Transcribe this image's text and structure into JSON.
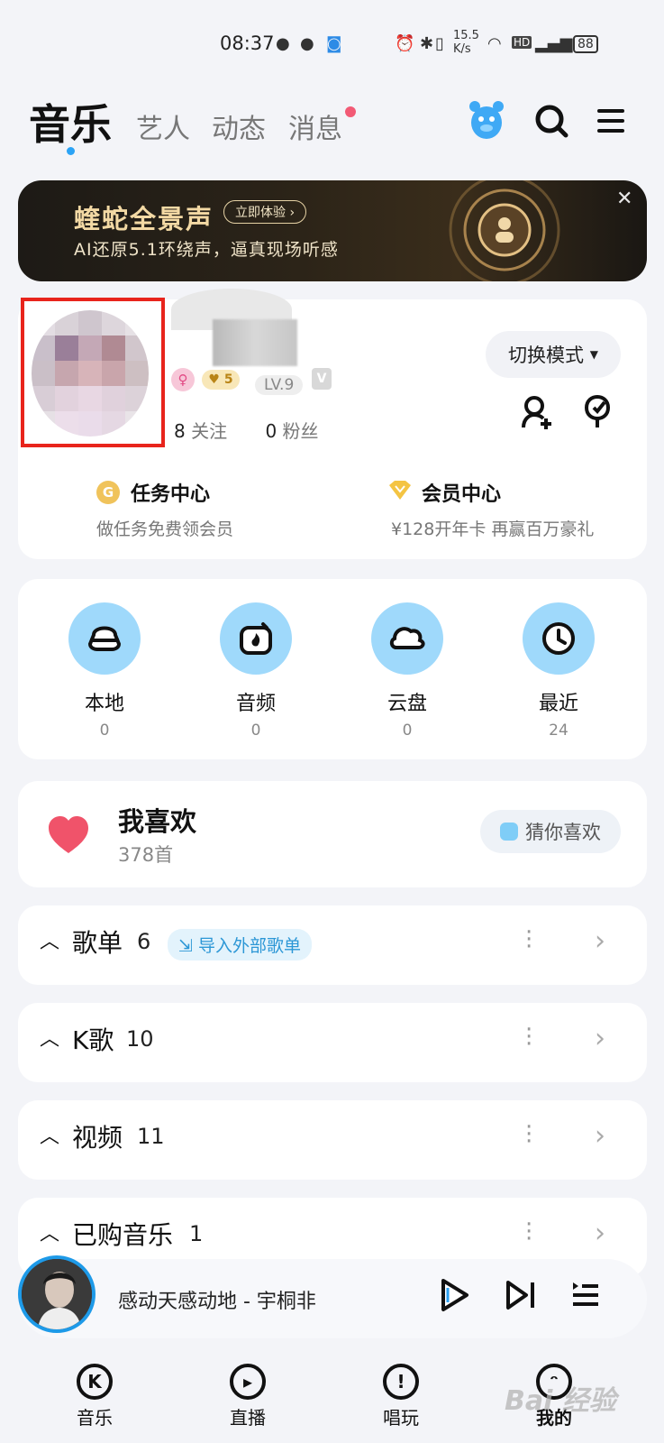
{
  "status_bar": {
    "time": "08:37",
    "net_speed": "15.5\nK/s",
    "battery": "88",
    "icons": [
      "wechat-icon",
      "message-icon",
      "app-icon",
      "alarm-icon",
      "bluetooth-icon",
      "vibrate-icon",
      "wifi-icon",
      "hd-icon",
      "signal-5g-icon",
      "battery-icon"
    ]
  },
  "nav": {
    "tabs": [
      "音乐",
      "艺人",
      "动态",
      "消息"
    ],
    "active_tab": "音乐",
    "icons": [
      "mascot-icon",
      "search-icon",
      "menu-icon"
    ]
  },
  "banner": {
    "title": "蝰蛇全景声",
    "button": "立即体验",
    "subtitle": "AI还原5.1环绕声，逼真现场听感"
  },
  "profile": {
    "level": "LV.9",
    "vip_level": "5",
    "following_count": "8",
    "following_label": "关注",
    "fans_count": "0",
    "fans_label": "粉丝",
    "switch_mode": "切换模式",
    "task_title": "任务中心",
    "task_sub": "做任务免费领会员",
    "vip_title": "会员中心",
    "vip_sub": "¥128开年卡 再赢百万豪礼"
  },
  "quick": [
    {
      "label": "本地",
      "count": "0",
      "icon": "local-icon"
    },
    {
      "label": "音频",
      "count": "0",
      "icon": "audio-icon"
    },
    {
      "label": "云盘",
      "count": "0",
      "icon": "cloud-icon"
    },
    {
      "label": "最近",
      "count": "24",
      "icon": "clock-icon"
    }
  ],
  "favorite": {
    "title": "我喜欢",
    "count": "378首",
    "guess": "猜你喜欢"
  },
  "lists": [
    {
      "title": "歌单",
      "count": "6",
      "extra": "导入外部歌单"
    },
    {
      "title": "K歌",
      "count": "10"
    },
    {
      "title": "视频",
      "count": "11"
    },
    {
      "title": "已购音乐",
      "count": "1"
    }
  ],
  "player": {
    "song": "感动天感动地 - 宇桐非"
  },
  "bottom_nav": [
    {
      "label": "音乐",
      "icon": "music-k-icon"
    },
    {
      "label": "直播",
      "icon": "live-icon"
    },
    {
      "label": "唱玩",
      "icon": "sing-icon"
    },
    {
      "label": "我的",
      "icon": "mine-icon"
    }
  ],
  "watermark": "Bai 经验"
}
